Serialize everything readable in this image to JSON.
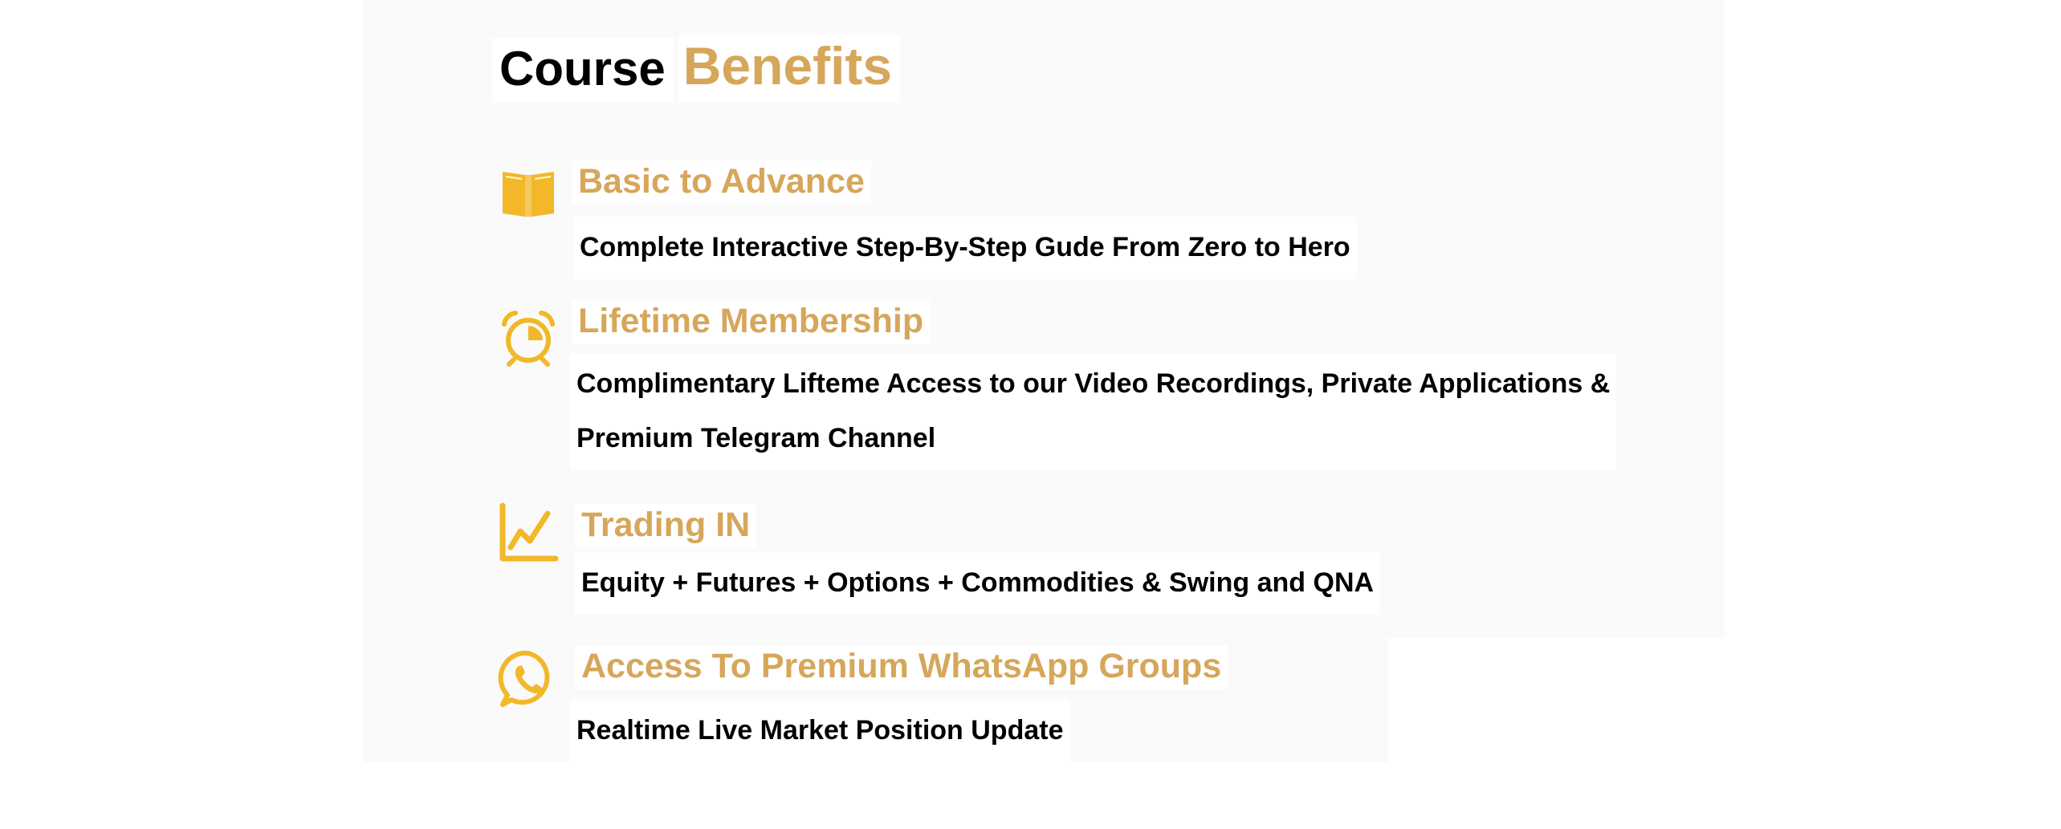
{
  "theme": {
    "accent": "#d6a65a",
    "icon_color": "#f2b829",
    "text": "#000000"
  },
  "section": {
    "title_part1": "Course",
    "title_part2": "Benefits"
  },
  "benefits": [
    {
      "icon": "open-book-icon",
      "heading": "Basic to Advance",
      "description": [
        "Complete Interactive Step-By-Step Gude From Zero to Hero"
      ]
    },
    {
      "icon": "alarm-clock-icon",
      "heading": "Lifetime Membership",
      "description": [
        "Complimentary Lifteme Access to our Video Recordings, Private Applications &",
        "Premium Telegram Channel"
      ]
    },
    {
      "icon": "line-chart-icon",
      "heading": "Trading IN",
      "description": [
        "Equity + Futures + Options + Commodities & Swing and QNA"
      ]
    },
    {
      "icon": "whatsapp-icon",
      "heading": "Access To Premium WhatsApp Groups",
      "description": [
        "Realtime Live Market Position Update"
      ]
    }
  ]
}
